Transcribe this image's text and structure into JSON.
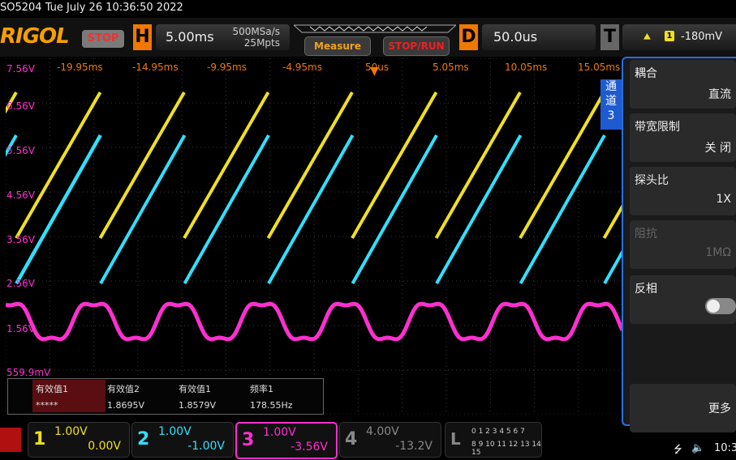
{
  "title": "SO5204   Tue July 26 10:36:50 2022",
  "brand": "RIGOL",
  "run_state": "STOP",
  "horizontal": {
    "key": "H",
    "timebase": "5.00ms",
    "sample_rate": "500MSa/s",
    "memory_depth": "25Mpts"
  },
  "buttons": {
    "measure": "Measure",
    "stop_run": "STOP/RUN"
  },
  "delay": {
    "key": "D",
    "value": "50.0us"
  },
  "trigger": {
    "key": "T",
    "source": "1",
    "level": "-180mV",
    "edge_icon": "rising-edge-icon"
  },
  "time_labels": [
    "-19.95ms",
    "-14.95ms",
    "-9.95ms",
    "-4.95ms",
    "50us",
    "5.05ms",
    "10.05ms",
    "15.05ms"
  ],
  "volt_labels": [
    "7.56V",
    "6.56V",
    "5.56V",
    "4.56V",
    "3.56V",
    "2.56V",
    "1.56V",
    "559.9mV"
  ],
  "measurements": [
    {
      "name": "有效值1",
      "value": "*****",
      "color": "#ff2fd0"
    },
    {
      "name": "有效值2",
      "value": "1.8695V",
      "color": "#30e0ff"
    },
    {
      "name": "有效值1",
      "value": "1.8579V",
      "color": "#f0e020"
    },
    {
      "name": "频率1",
      "value": "178.55Hz",
      "color": "#f0e020"
    }
  ],
  "channels": [
    {
      "num": "1",
      "scale": "1.00V",
      "offset": "0.00V",
      "color": "#f0e020"
    },
    {
      "num": "2",
      "scale": "1.00V",
      "offset": "-1.00V",
      "color": "#30e0ff"
    },
    {
      "num": "3",
      "scale": "1.00V",
      "offset": "-3.56V",
      "color": "#ff2fd0"
    },
    {
      "num": "4",
      "scale": "4.00V",
      "offset": "-13.2V",
      "color": "#888888"
    }
  ],
  "logic": {
    "key": "L",
    "row1": "0 1 2 3   4 5 6 7",
    "row2": "8 9 10 11 12 13 14 15"
  },
  "menu": {
    "tab": [
      "通",
      "道",
      "3"
    ],
    "items": [
      {
        "label": "耦合",
        "value": "直流"
      },
      {
        "label": "带宽限制",
        "value": "关 闭"
      },
      {
        "label": "探头比",
        "value": "1X"
      },
      {
        "label": "阻抗",
        "value": "1MΩ"
      },
      {
        "label": "反相",
        "value": ""
      },
      {
        "label": "",
        "value": "更多"
      }
    ]
  },
  "status": {
    "time": "10:3"
  },
  "colors": {
    "accent": "#f07800",
    "menu_border": "#2a6ee0"
  }
}
